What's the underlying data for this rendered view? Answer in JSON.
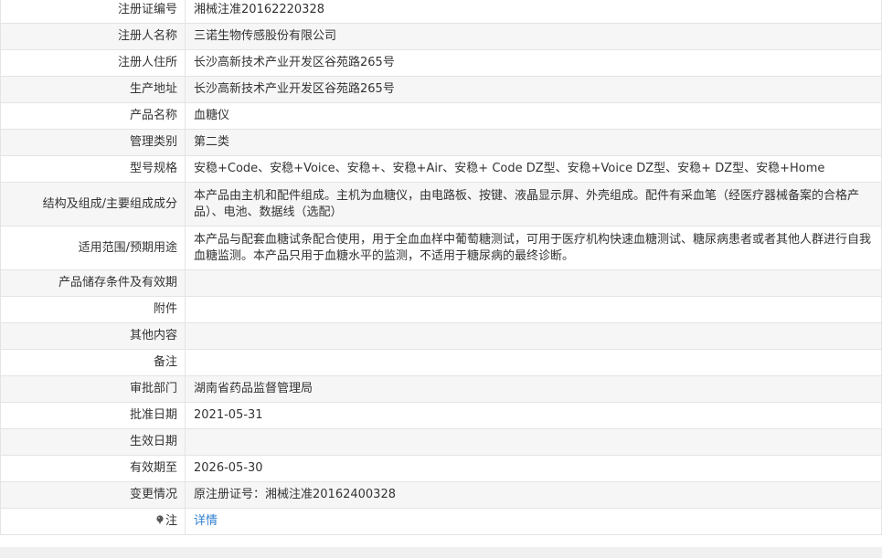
{
  "rows": [
    {
      "label": "注册证编号",
      "value": "湘械注准20162220328"
    },
    {
      "label": "注册人名称",
      "value": "三诺生物传感股份有限公司"
    },
    {
      "label": "注册人住所",
      "value": "长沙高新技术产业开发区谷苑路265号"
    },
    {
      "label": "生产地址",
      "value": "长沙高新技术产业开发区谷苑路265号"
    },
    {
      "label": "产品名称",
      "value": "血糖仪"
    },
    {
      "label": "管理类别",
      "value": "第二类"
    },
    {
      "label": "型号规格",
      "value": "安稳+Code、安稳+Voice、安稳+、安稳+Air、安稳+ Code DZ型、安稳+Voice DZ型、安稳+ DZ型、安稳+Home"
    },
    {
      "label": "结构及组成/主要组成成分",
      "value": "本产品由主机和配件组成。主机为血糖仪，由电路板、按键、液晶显示屏、外壳组成。配件有采血笔（经医疗器械备案的合格产品）、电池、数据线（选配）"
    },
    {
      "label": "适用范围/预期用途",
      "value": "本产品与配套血糖试条配合使用，用于全血血样中葡萄糖测试，可用于医疗机构快速血糖测试、糖尿病患者或者其他人群进行自我血糖监测。本产品只用于血糖水平的监测，不适用于糖尿病的最终诊断。"
    },
    {
      "label": "产品储存条件及有效期",
      "value": ""
    },
    {
      "label": "附件",
      "value": ""
    },
    {
      "label": "其他内容",
      "value": ""
    },
    {
      "label": "备注",
      "value": ""
    },
    {
      "label": "审批部门",
      "value": "湖南省药品监督管理局"
    },
    {
      "label": "批准日期",
      "value": "2021-05-31"
    },
    {
      "label": "生效日期",
      "value": ""
    },
    {
      "label": "有效期至",
      "value": "2026-05-30"
    },
    {
      "label": "变更情况",
      "value": "原注册证号：湘械注准20162400328"
    }
  ],
  "note": {
    "label": "注",
    "icon": "pin-icon",
    "link_text": "详情",
    "link_color": "#2f7fd1"
  }
}
